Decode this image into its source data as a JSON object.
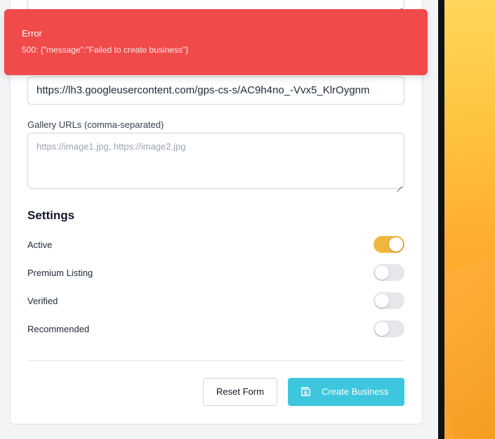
{
  "form": {
    "image_url_value": "https://lh3.googleusercontent.com/gps-cs-s/AC9h4no_-Vvx5_KlrOygnm",
    "gallery_label": "Gallery URLs (comma-separated)",
    "gallery_placeholder": "https://image1.jpg, https://image2.jpg"
  },
  "settings": {
    "title": "Settings",
    "toggles": [
      {
        "label": "Active",
        "on": true
      },
      {
        "label": "Premium Listing",
        "on": false
      },
      {
        "label": "Verified",
        "on": false
      },
      {
        "label": "Recommended",
        "on": false
      }
    ]
  },
  "actions": {
    "reset_label": "Reset Form",
    "create_label": "Create Business",
    "create_icon": "save-icon"
  },
  "toast": {
    "title": "Error",
    "message": "500: {\"message\":\"Failed to create business\"}"
  },
  "colors": {
    "toast_bg": "#f04a4a",
    "toggle_on": "#f0b73f",
    "primary_button": "#3ec6df"
  }
}
